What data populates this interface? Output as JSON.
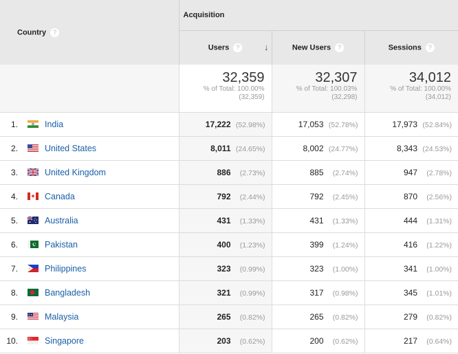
{
  "header": {
    "country_label": "Country",
    "group_label": "Acquisition",
    "metrics": [
      {
        "label": "Users",
        "sorted": true
      },
      {
        "label": "New Users",
        "sorted": false
      },
      {
        "label": "Sessions",
        "sorted": false
      }
    ],
    "help_glyph": "?",
    "sort_glyph": "↓"
  },
  "totals": {
    "users": {
      "value": "32,359",
      "pct": "% of Total: 100.00%",
      "abs": "(32,359)"
    },
    "new_users": {
      "value": "32,307",
      "pct": "% of Total: 100.03%",
      "abs": "(32,298)"
    },
    "sessions": {
      "value": "34,012",
      "pct": "% of Total: 100.00%",
      "abs": "(34,012)"
    }
  },
  "rows": [
    {
      "index": "1.",
      "country": "India",
      "flag": "flag-india-icon",
      "users": "17,222",
      "users_pct": "(52.98%)",
      "new_users": "17,053",
      "new_users_pct": "(52.78%)",
      "sessions": "17,973",
      "sessions_pct": "(52.84%)"
    },
    {
      "index": "2.",
      "country": "United States",
      "flag": "flag-us-icon",
      "users": "8,011",
      "users_pct": "(24.65%)",
      "new_users": "8,002",
      "new_users_pct": "(24.77%)",
      "sessions": "8,343",
      "sessions_pct": "(24.53%)"
    },
    {
      "index": "3.",
      "country": "United Kingdom",
      "flag": "flag-uk-icon",
      "users": "886",
      "users_pct": "(2.73%)",
      "new_users": "885",
      "new_users_pct": "(2.74%)",
      "sessions": "947",
      "sessions_pct": "(2.78%)"
    },
    {
      "index": "4.",
      "country": "Canada",
      "flag": "flag-canada-icon",
      "users": "792",
      "users_pct": "(2.44%)",
      "new_users": "792",
      "new_users_pct": "(2.45%)",
      "sessions": "870",
      "sessions_pct": "(2.56%)"
    },
    {
      "index": "5.",
      "country": "Australia",
      "flag": "flag-australia-icon",
      "users": "431",
      "users_pct": "(1.33%)",
      "new_users": "431",
      "new_users_pct": "(1.33%)",
      "sessions": "444",
      "sessions_pct": "(1.31%)"
    },
    {
      "index": "6.",
      "country": "Pakistan",
      "flag": "flag-pakistan-icon",
      "users": "400",
      "users_pct": "(1.23%)",
      "new_users": "399",
      "new_users_pct": "(1.24%)",
      "sessions": "416",
      "sessions_pct": "(1.22%)"
    },
    {
      "index": "7.",
      "country": "Philippines",
      "flag": "flag-philippines-icon",
      "users": "323",
      "users_pct": "(0.99%)",
      "new_users": "323",
      "new_users_pct": "(1.00%)",
      "sessions": "341",
      "sessions_pct": "(1.00%)"
    },
    {
      "index": "8.",
      "country": "Bangladesh",
      "flag": "flag-bangladesh-icon",
      "users": "321",
      "users_pct": "(0.99%)",
      "new_users": "317",
      "new_users_pct": "(0.98%)",
      "sessions": "345",
      "sessions_pct": "(1.01%)"
    },
    {
      "index": "9.",
      "country": "Malaysia",
      "flag": "flag-malaysia-icon",
      "users": "265",
      "users_pct": "(0.82%)",
      "new_users": "265",
      "new_users_pct": "(0.82%)",
      "sessions": "279",
      "sessions_pct": "(0.82%)"
    },
    {
      "index": "10.",
      "country": "Singapore",
      "flag": "flag-singapore-icon",
      "users": "203",
      "users_pct": "(0.62%)",
      "new_users": "200",
      "new_users_pct": "(0.62%)",
      "sessions": "217",
      "sessions_pct": "(0.64%)"
    }
  ],
  "colors": {
    "link": "#1a5fa8",
    "header_bg": "#e8e8e8",
    "sorted_col_bg": "#f6f6f6"
  }
}
